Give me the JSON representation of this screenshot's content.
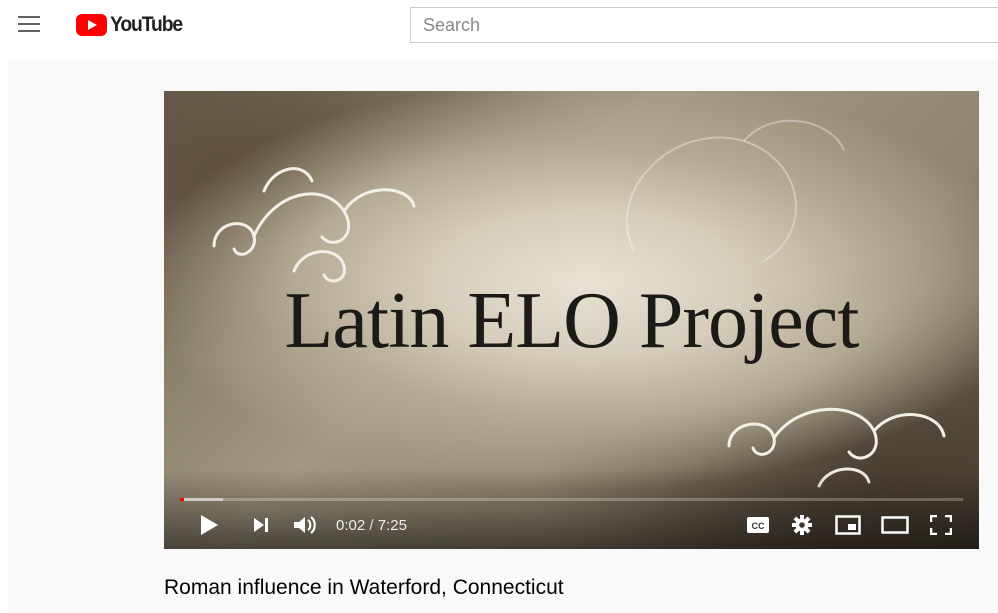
{
  "header": {
    "brand": "YouTube",
    "search_placeholder": "Search"
  },
  "video": {
    "frame_title": "Latin ELO Project",
    "time_current": "0:02",
    "time_separator": " / ",
    "time_total": "7:25",
    "played_fraction": 0.0045,
    "loaded_fraction": 0.055
  },
  "caption": "Roman influence in Waterford, Connecticut",
  "icons": [
    "menu-icon",
    "youtube-logo-icon",
    "play-icon",
    "next-icon",
    "volume-icon",
    "captions-icon",
    "settings-icon",
    "miniplayer-icon",
    "theater-mode-icon",
    "fullscreen-icon"
  ],
  "colors": {
    "brand_red": "#ff0000",
    "progress_played": "#ff0000",
    "text": "#030303"
  }
}
